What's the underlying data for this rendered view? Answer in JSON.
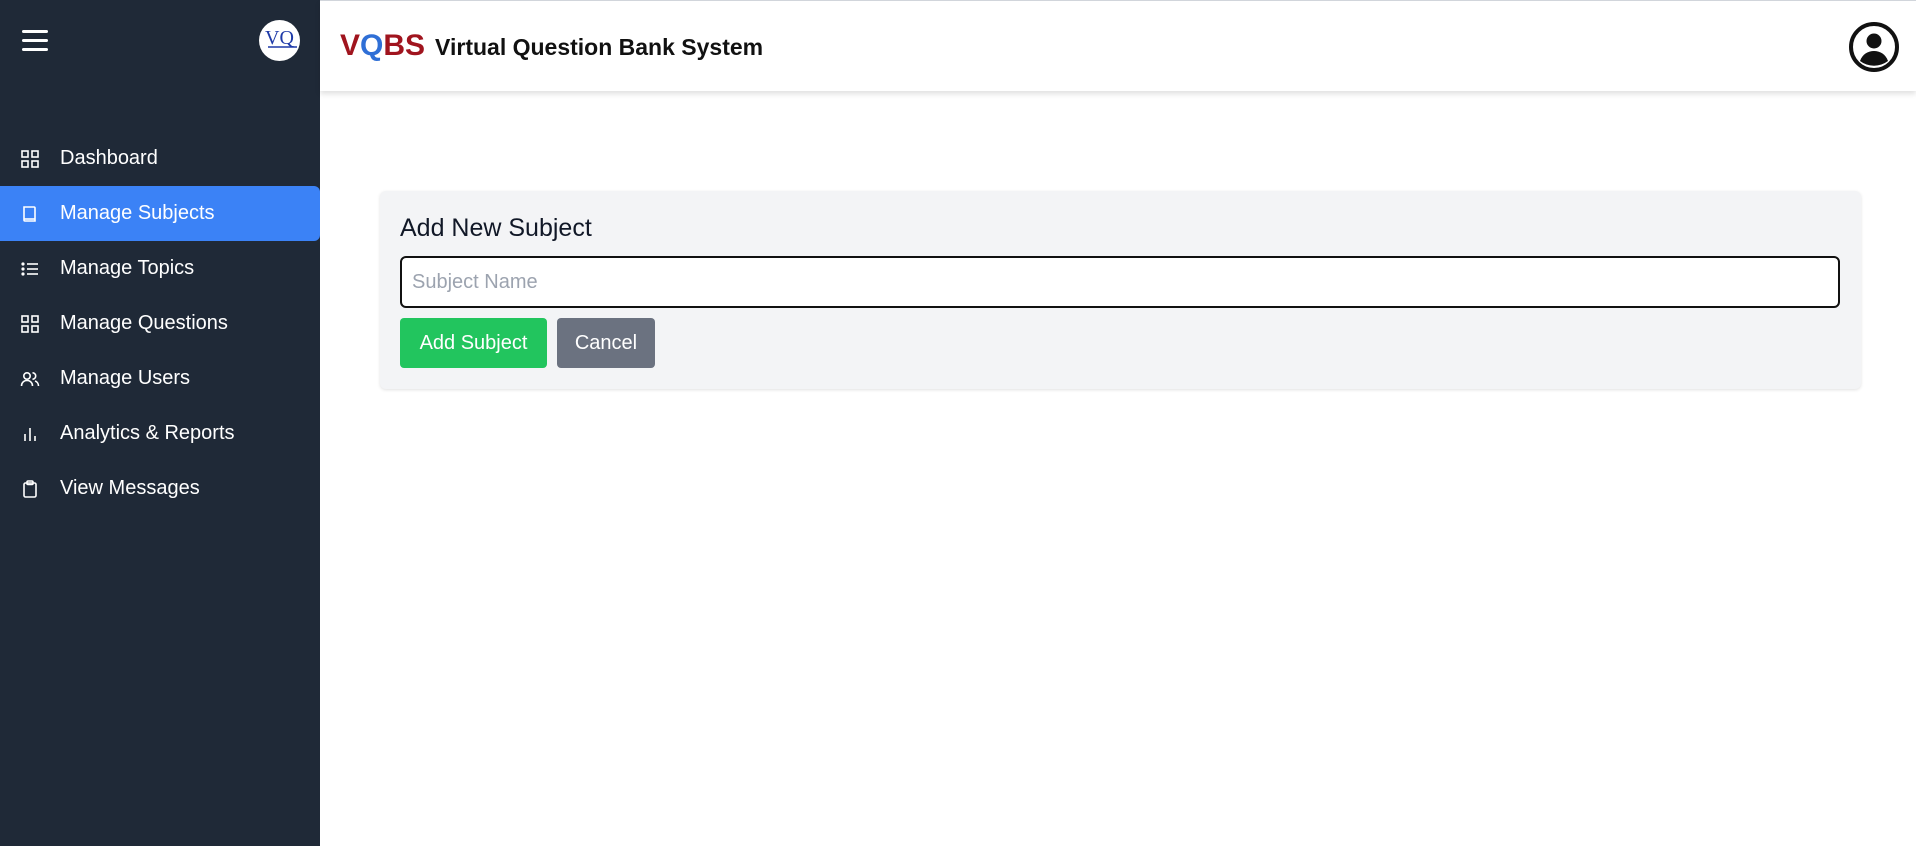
{
  "app": {
    "brand_letters": {
      "v": "V",
      "q": "Q",
      "b": "B",
      "s": "S"
    },
    "title": "Virtual Question Bank System",
    "logo_text": "VQ"
  },
  "sidebar": {
    "items": [
      {
        "label": "Dashboard",
        "icon": "grid-icon",
        "active": false
      },
      {
        "label": "Manage Subjects",
        "icon": "book-icon",
        "active": true
      },
      {
        "label": "Manage Topics",
        "icon": "list-icon",
        "active": false
      },
      {
        "label": "Manage Questions",
        "icon": "grid-icon",
        "active": false
      },
      {
        "label": "Manage Users",
        "icon": "users-icon",
        "active": false
      },
      {
        "label": "Analytics & Reports",
        "icon": "bar-chart-icon",
        "active": false
      },
      {
        "label": "View Messages",
        "icon": "clipboard-icon",
        "active": false
      }
    ]
  },
  "form": {
    "title": "Add New Subject",
    "input_placeholder": "Subject Name",
    "input_value": "",
    "add_label": "Add Subject",
    "cancel_label": "Cancel"
  },
  "colors": {
    "sidebar_bg": "#1f2937",
    "active_item": "#3b82f6",
    "brand_red": "#a0141e",
    "brand_blue": "#2f6fd6",
    "add_button": "#22c55e",
    "cancel_button": "#6b7280"
  }
}
